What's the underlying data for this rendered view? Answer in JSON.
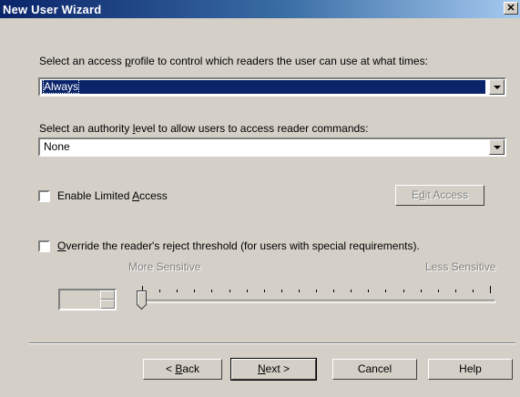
{
  "window": {
    "title": "New User Wizard",
    "close_glyph": "✕"
  },
  "access_profile": {
    "label_pre": "Select an access ",
    "label_accel": "p",
    "label_post": "rofile to control which readers the user can use at what times:",
    "selected": "Always"
  },
  "authority": {
    "label_pre": "Select an authority ",
    "label_accel": "l",
    "label_post": "evel to allow users to access reader commands:",
    "selected": "None"
  },
  "limited_access": {
    "label_pre": "Enable Limited ",
    "label_accel": "A",
    "label_post": "ccess",
    "checked": false,
    "button_pre": "E",
    "button_accel": "d",
    "button_post": "it Access",
    "button_enabled": false
  },
  "threshold": {
    "label_accel": "O",
    "label_post": "verride the reader's reject threshold (for users with special requirements).",
    "checked": false,
    "more_label": "More Sensitive",
    "less_label": "Less Sensitive",
    "spin_value": "",
    "slider_position": 0,
    "tick_count": 21
  },
  "footer": {
    "back_pre": "< ",
    "back_accel": "B",
    "back_post": "ack",
    "next_accel": "N",
    "next_post": "ext >",
    "cancel": "Cancel",
    "help": "Help"
  },
  "colors": {
    "face": "#d4d0c8",
    "title_active": "#0a246a",
    "selection": "#0a246a"
  }
}
